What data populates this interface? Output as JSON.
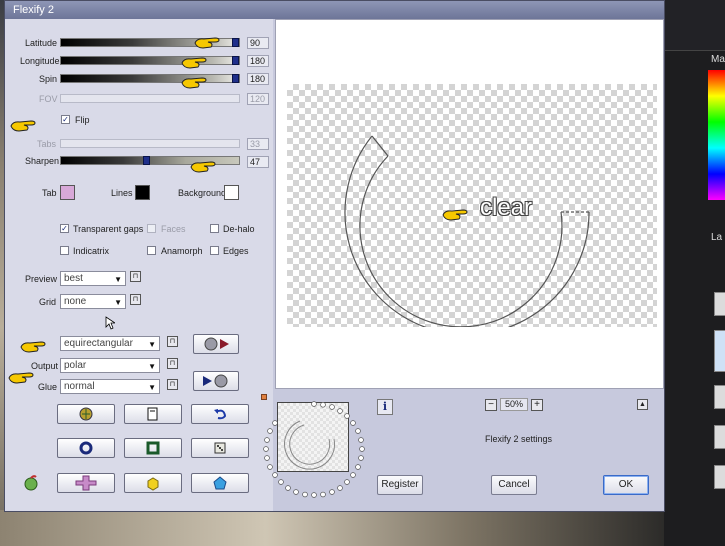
{
  "window": {
    "title": "Flexify 2"
  },
  "background_app": {
    "panel_labels": [
      "Ma",
      "La"
    ]
  },
  "sliders": [
    {
      "name": "latitude",
      "label": "Latitude",
      "value": "90",
      "enabled": true,
      "level": 1.0
    },
    {
      "name": "longitude",
      "label": "Longitude",
      "value": "180",
      "enabled": true,
      "level": 1.0
    },
    {
      "name": "spin",
      "label": "Spin",
      "value": "180",
      "enabled": true,
      "level": 1.0
    },
    {
      "name": "fov",
      "label": "FOV",
      "value": "120",
      "enabled": false,
      "level": 0.0
    },
    {
      "name": "tabs",
      "label": "Tabs",
      "value": "33",
      "enabled": false,
      "level": 0.0
    },
    {
      "name": "sharpen",
      "label": "Sharpen",
      "value": "47",
      "enabled": true,
      "level": 0.47
    }
  ],
  "flip": {
    "label": "Flip",
    "checked": true
  },
  "colors": {
    "tab_label": "Tab",
    "tab_color": "#d8a8d8",
    "lines_label": "Lines",
    "lines_color": "#000000",
    "background_label": "Background",
    "background_color": "#ffffff"
  },
  "options": [
    {
      "label": "Transparent gaps",
      "checked": true,
      "enabled": true
    },
    {
      "label": "Faces",
      "checked": false,
      "enabled": false
    },
    {
      "label": "De-halo",
      "checked": false,
      "enabled": true
    },
    {
      "label": "Indicatrix",
      "checked": false,
      "enabled": true
    },
    {
      "label": "Anamorph",
      "checked": false,
      "enabled": true
    },
    {
      "label": "Edges",
      "checked": false,
      "enabled": true
    }
  ],
  "preview_select": {
    "label": "Preview",
    "value": "best"
  },
  "grid_select": {
    "label": "Grid",
    "value": "none"
  },
  "input_select": {
    "value": "equirectangular"
  },
  "output_select": {
    "label": "Output",
    "value": "polar"
  },
  "glue_select": {
    "label": "Glue",
    "value": "normal"
  },
  "preview": {
    "overlay_text": "clear",
    "zoom": "50%",
    "zoom_minus": "−",
    "zoom_plus": "+"
  },
  "settings_label": "Flexify 2 settings",
  "buttons": {
    "register": "Register",
    "cancel": "Cancel",
    "ok": "OK"
  },
  "info_label": "i"
}
